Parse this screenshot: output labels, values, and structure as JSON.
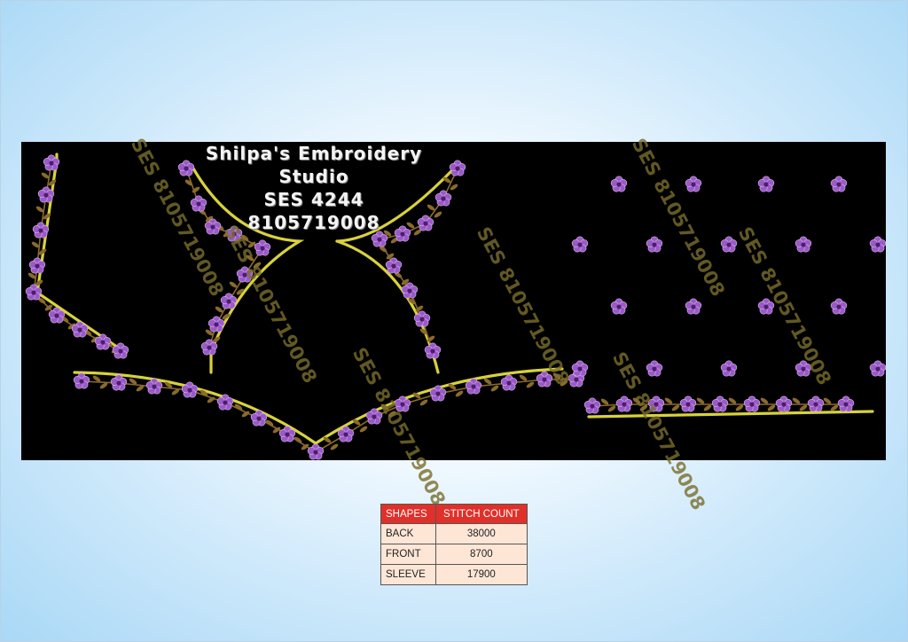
{
  "design": {
    "studio": "Shilpa's Embroidery Studio",
    "code": "SES 4244",
    "phone": "8105719008",
    "watermarks": [
      "SES 8105719008",
      "SES 8105719008",
      "SES 8105719008",
      "SES 8105719008",
      "SES 8105719008",
      "SES 8105719008",
      "SES 8105719008"
    ],
    "colors": {
      "background": "#000000",
      "border": "#d8d23a",
      "flower": "#9b5ac8",
      "leaf": "#8a6a2c"
    }
  },
  "stitch_table": {
    "headers": [
      "SHAPES",
      "STITCH COUNT"
    ],
    "rows": [
      {
        "shape": "BACK",
        "count": "38000"
      },
      {
        "shape": "FRONT",
        "count": "8700"
      },
      {
        "shape": "SLEEVE",
        "count": "17900"
      }
    ],
    "colors": {
      "header": "#e1302a",
      "cell": "#fde6d6"
    }
  }
}
